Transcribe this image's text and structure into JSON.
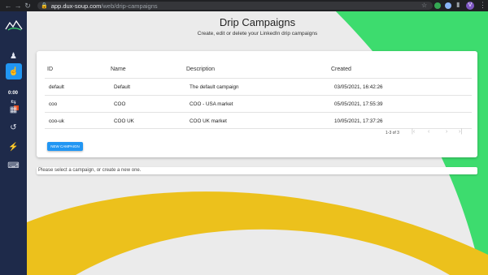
{
  "browser": {
    "url_host": "app.dux-soup.com",
    "url_path": "/web/drip-campaigns",
    "avatar_letter": "V"
  },
  "sidebar": {
    "timer": "0:00",
    "icons": [
      "user-icon",
      "hand-pointer-icon",
      "loop-icon",
      "table-icon",
      "history-icon",
      "plug-icon",
      "keyboard-icon"
    ]
  },
  "page": {
    "title": "Drip Campaigns",
    "subtitle": "Create, edit or delete your LinkedIn drip campaigns"
  },
  "table": {
    "headers": {
      "id": "ID",
      "name": "Name",
      "description": "Description",
      "created": "Created"
    },
    "rows": [
      {
        "id": "default",
        "name": "Default",
        "description": "The default campaign",
        "created": "03/05/2021, 16:42:26"
      },
      {
        "id": "coo",
        "name": "COO",
        "description": "COO - USA market",
        "created": "05/05/2021, 17:55:39"
      },
      {
        "id": "coo-uk",
        "name": "COO UK",
        "description": "COO UK market",
        "created": "10/05/2021, 17:37:26"
      }
    ],
    "pagination": "1-3 of 3"
  },
  "buttons": {
    "new_campaign": "NEW CAMPAIGN"
  },
  "message": "Please select a campaign, or create a new one.",
  "colors": {
    "sidebar": "#1e2a4a",
    "accent": "#2196f3",
    "green_stripe": "#3ddc6e",
    "yellow_stripe": "#ecc11c"
  }
}
